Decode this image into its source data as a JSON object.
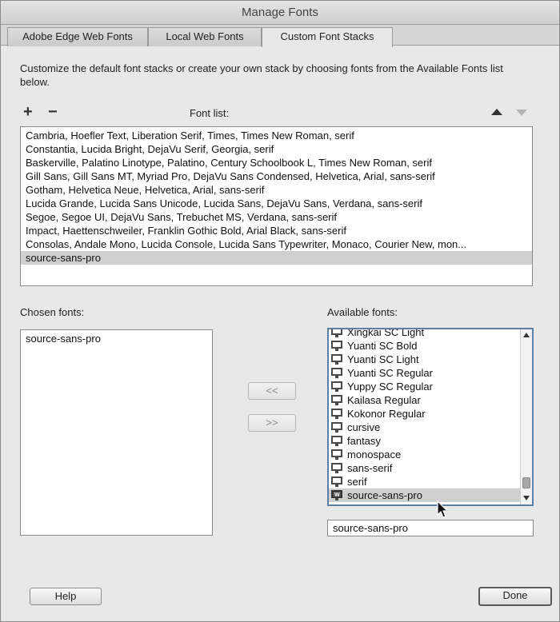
{
  "window": {
    "title": "Manage Fonts"
  },
  "tabs": [
    {
      "label": "Adobe Edge Web Fonts"
    },
    {
      "label": "Local Web Fonts"
    },
    {
      "label": "Custom Font Stacks"
    }
  ],
  "description": "Customize the default font stacks or create your own stack by choosing fonts from the Available Fonts list below.",
  "font_list": {
    "label": "Font list:",
    "add_symbol": "+",
    "remove_symbol": "−",
    "items": [
      "Cambria, Hoefler Text, Liberation Serif, Times, Times New Roman, serif",
      "Constantia, Lucida Bright, DejaVu Serif, Georgia, serif",
      "Baskerville, Palatino Linotype, Palatino, Century Schoolbook L, Times New Roman, serif",
      "Gill Sans, Gill Sans MT, Myriad Pro, DejaVu Sans Condensed, Helvetica, Arial, sans-serif",
      "Gotham, Helvetica Neue, Helvetica, Arial, sans-serif",
      "Lucida Grande, Lucida Sans Unicode, Lucida Sans, DejaVu Sans, Verdana, sans-serif",
      "Segoe, Segoe UI, DejaVu Sans, Trebuchet MS, Verdana, sans-serif",
      "Impact, Haettenschweiler, Franklin Gothic Bold, Arial Black, sans-serif",
      "Consolas, Andale Mono, Lucida Console, Lucida Sans Typewriter, Monaco, Courier New, mon...",
      "source-sans-pro"
    ],
    "selected": "source-sans-pro"
  },
  "chosen_fonts": {
    "label": "Chosen fonts:",
    "items": [
      "source-sans-pro"
    ]
  },
  "move_buttons": {
    "add_label": "<<",
    "remove_label": ">>"
  },
  "available_fonts": {
    "label": "Available fonts:",
    "items": [
      {
        "name": "Xingkai SC Light",
        "icon": "system-font-icon"
      },
      {
        "name": "Yuanti SC Bold",
        "icon": "system-font-icon"
      },
      {
        "name": "Yuanti SC Light",
        "icon": "system-font-icon"
      },
      {
        "name": "Yuanti SC Regular",
        "icon": "system-font-icon"
      },
      {
        "name": "Yuppy SC Regular",
        "icon": "system-font-icon"
      },
      {
        "name": "Kailasa Regular",
        "icon": "system-font-icon"
      },
      {
        "name": "Kokonor Regular",
        "icon": "system-font-icon"
      },
      {
        "name": "cursive",
        "icon": "system-font-icon"
      },
      {
        "name": "fantasy",
        "icon": "system-font-icon"
      },
      {
        "name": "monospace",
        "icon": "system-font-icon"
      },
      {
        "name": "sans-serif",
        "icon": "system-font-icon"
      },
      {
        "name": "serif",
        "icon": "system-font-icon"
      },
      {
        "name": "source-sans-pro",
        "icon": "web-font-icon"
      }
    ],
    "selected": "source-sans-pro",
    "filter_value": "source-sans-pro"
  },
  "footer": {
    "help_label": "Help",
    "done_label": "Done"
  }
}
